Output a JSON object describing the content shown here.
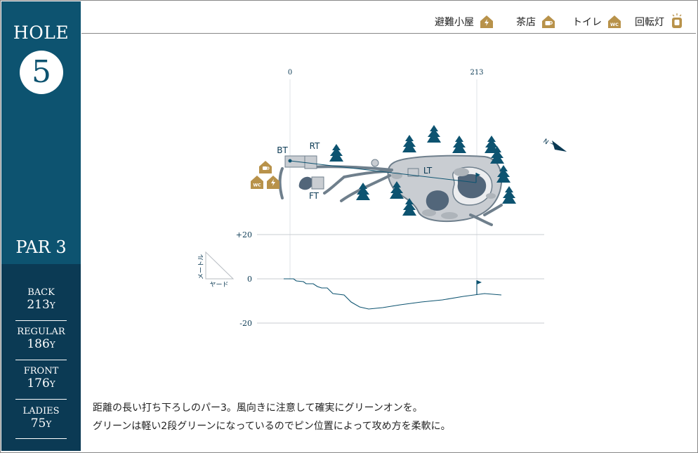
{
  "hole": {
    "label": "HOLE",
    "number": "5",
    "par": "PAR 3"
  },
  "tees": [
    {
      "name": "BACK",
      "distance": "213",
      "unit": "Y"
    },
    {
      "name": "REGULAR",
      "distance": "186",
      "unit": "Y"
    },
    {
      "name": "FRONT",
      "distance": "176",
      "unit": "Y"
    },
    {
      "name": "LADIES",
      "distance": "75",
      "unit": "Y"
    }
  ],
  "legend": {
    "shelter": "避難小屋",
    "teahouse": "茶店",
    "toilet": "トイレ",
    "beacon": "回転灯"
  },
  "map": {
    "dist_start": "0",
    "dist_end": "213",
    "tee_labels": {
      "bt": "BT",
      "rt": "RT",
      "ft": "FT",
      "lt": "LT"
    },
    "north": "N",
    "wc": "WC"
  },
  "profile": {
    "plus": "+20",
    "zero": "0",
    "minus": "-20",
    "scale_vertical": "メートル",
    "scale_horizontal": "ヤード"
  },
  "description": {
    "line1": "距離の長い打ち下ろしのパー3。風向きに注意して確実にグリーンオンを。",
    "line2": "グリーンは軽い2段グリーンになっているのでピン位置によって攻め方を柔軟に。"
  },
  "colors": {
    "navy": "#0d5370",
    "dark_navy": "#0b3a54",
    "gold": "#b8924a",
    "path": "#6f7f8c",
    "green": "#c9cdd2"
  }
}
